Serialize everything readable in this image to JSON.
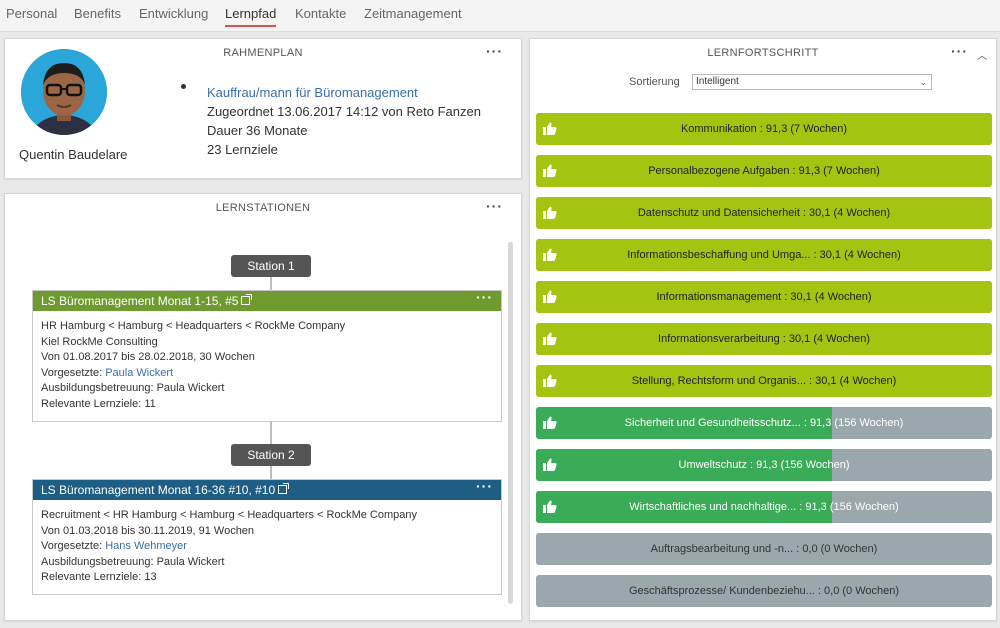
{
  "nav": {
    "tabs": [
      {
        "label": "Personal"
      },
      {
        "label": "Benefits"
      },
      {
        "label": "Entwicklung"
      },
      {
        "label": "Lernpfad"
      },
      {
        "label": "Kontakte"
      },
      {
        "label": "Zeitmanagement"
      }
    ],
    "active_tab": "Lernpfad"
  },
  "rahmenplan": {
    "title": "RAHMENPLAN",
    "person_name": "Quentin Baudelare",
    "plan_link": "Kauffrau/mann für Büromanagement",
    "assigned": "Zugeordnet 13.06.2017 14:12 von Reto Fanzen",
    "duration": "Dauer 36 Monate",
    "goals": "23 Lernziele"
  },
  "lernstationen": {
    "title": "LERNSTATIONEN",
    "stations": [
      {
        "pill": "Station 1",
        "header": "LS Büromanagement Monat 1-15, #5",
        "header_color": "#6e9a2f",
        "line1": "HR Hamburg < Hamburg < Headquarters < RockMe Company",
        "line2": "Kiel RockMe Consulting",
        "line3": "Von 01.08.2017 bis 28.02.2018, 30 Wochen",
        "supervisor_label": "Vorgesetzte: ",
        "supervisor": "Paula Wickert",
        "training": "Ausbildungsbetreuung: Paula Wickert",
        "goals": "Relevante Lernziele: 11"
      },
      {
        "pill": "Station 2",
        "header": "LS Büromanagement Monat 16-36 #10, #10",
        "header_color": "#1e5d84",
        "line1": "Recruitment < HR Hamburg < Hamburg < Headquarters < RockMe Company",
        "line3": "Von 01.03.2018 bis 30.11.2019, 91 Wochen",
        "supervisor_label": "Vorgesetzte: ",
        "supervisor": "Hans Wehmeyer",
        "training": "Ausbildungsbetreuung: Paula Wickert",
        "goals": "Relevante Lernziele: 13"
      }
    ]
  },
  "lernfortschritt": {
    "title": "LERNFORTSCHRITT",
    "sort_label": "Sortierung",
    "sort_value": "Intelligent",
    "colors": {
      "lime": "#a4c411",
      "green": "#3aab57",
      "grey": "#9aa7ad"
    },
    "bars": [
      {
        "label": "Kommunikation : 91,3 (7 Wochen)",
        "style": "lime",
        "fill": 1.0
      },
      {
        "label": "Personalbezogene Aufgaben : 91,3 (7 Wochen)",
        "style": "lime",
        "fill": 1.0
      },
      {
        "label": "Datenschutz und Datensicherheit : 30,1 (4 Wochen)",
        "style": "lime",
        "fill": 1.0
      },
      {
        "label": "Informationsbeschaffung und Umga... : 30,1 (4 Wochen)",
        "style": "lime",
        "fill": 1.0
      },
      {
        "label": "Informationsmanagement : 30,1 (4 Wochen)",
        "style": "lime",
        "fill": 1.0
      },
      {
        "label": "Informationsverarbeitung : 30,1 (4 Wochen)",
        "style": "lime",
        "fill": 1.0
      },
      {
        "label": "Stellung, Rechtsform und Organis... : 30,1 (4 Wochen)",
        "style": "lime",
        "fill": 1.0
      },
      {
        "label": "Sicherheit und Gesundheitsschutz... : 91,3 (156 Wochen)",
        "style": "green",
        "fill": 0.65
      },
      {
        "label": "Umweltschutz : 91,3 (156 Wochen)",
        "style": "green",
        "fill": 0.65
      },
      {
        "label": "Wirtschaftliches und nachhaltige... : 91,3 (156 Wochen)",
        "style": "green",
        "fill": 0.65
      },
      {
        "label": "Auftragsbearbeitung und -n... : 0,0 (0 Wochen)",
        "style": "grey",
        "fill": 0.0
      },
      {
        "label": "Geschäftsprozesse/ Kundenbeziehu... : 0,0 (0 Wochen)",
        "style": "grey",
        "fill": 0.0
      }
    ]
  }
}
